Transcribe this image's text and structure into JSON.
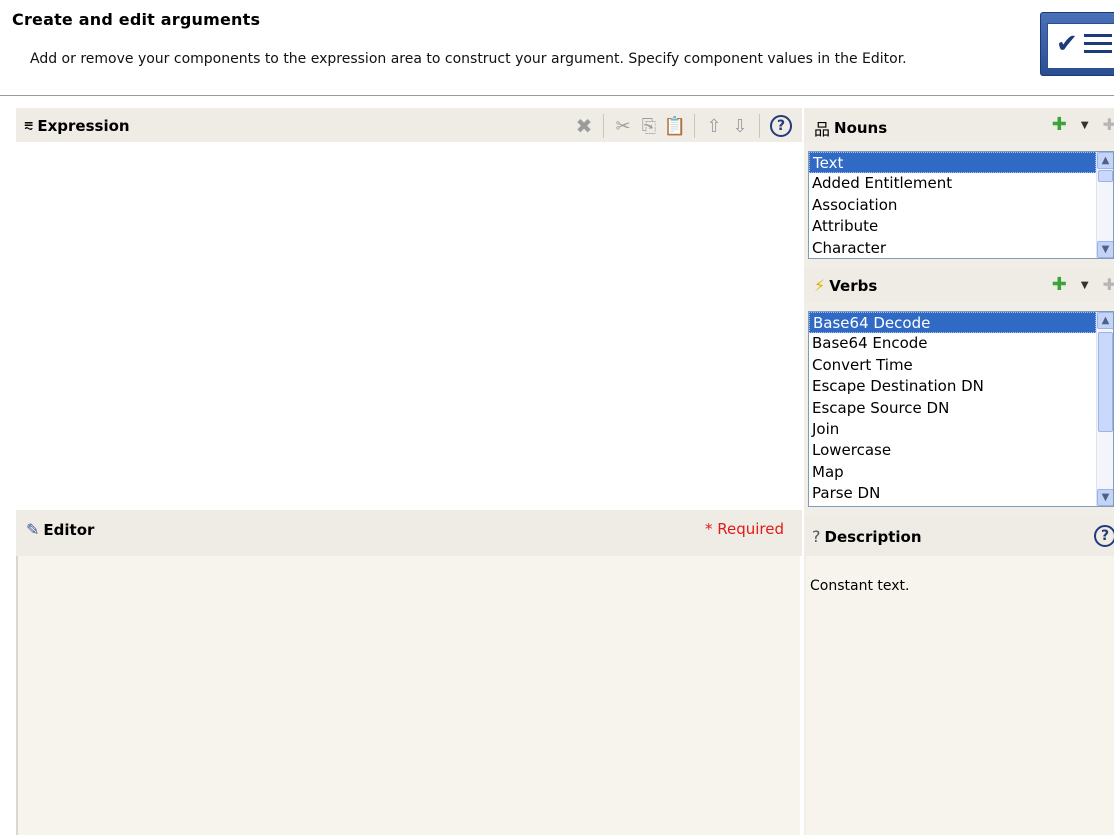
{
  "header": {
    "title": "Create and edit arguments",
    "subtitle": "Add or remove your components to the expression area to construct your argument. Specify component values in the Editor."
  },
  "expression": {
    "title": "Expression",
    "toolbar": [
      "delete-icon",
      "cut-icon",
      "copy-icon",
      "paste-icon",
      "move-up-icon",
      "move-down-icon",
      "help-icon"
    ],
    "help_glyph": "?"
  },
  "editor": {
    "title": "Editor",
    "required_label": "* Required"
  },
  "nouns": {
    "title": "Nouns",
    "items": [
      "Text",
      "Added Entitlement",
      "Association",
      "Attribute",
      "Character"
    ],
    "selected": "Text"
  },
  "verbs": {
    "title": "Verbs",
    "items": [
      "Base64 Decode",
      "Base64 Encode",
      "Convert Time",
      "Escape Destination DN",
      "Escape Source DN",
      "Join",
      "Lowercase",
      "Map",
      "Parse DN"
    ],
    "selected": "Base64 Decode"
  },
  "description": {
    "title": "Description",
    "text": "Constant text.",
    "help_glyph": "?"
  },
  "colors": {
    "selection": "#316ac5",
    "panel_bg": "#eeece4",
    "required": "#e21a1a",
    "add_green": "#3aa43a"
  }
}
